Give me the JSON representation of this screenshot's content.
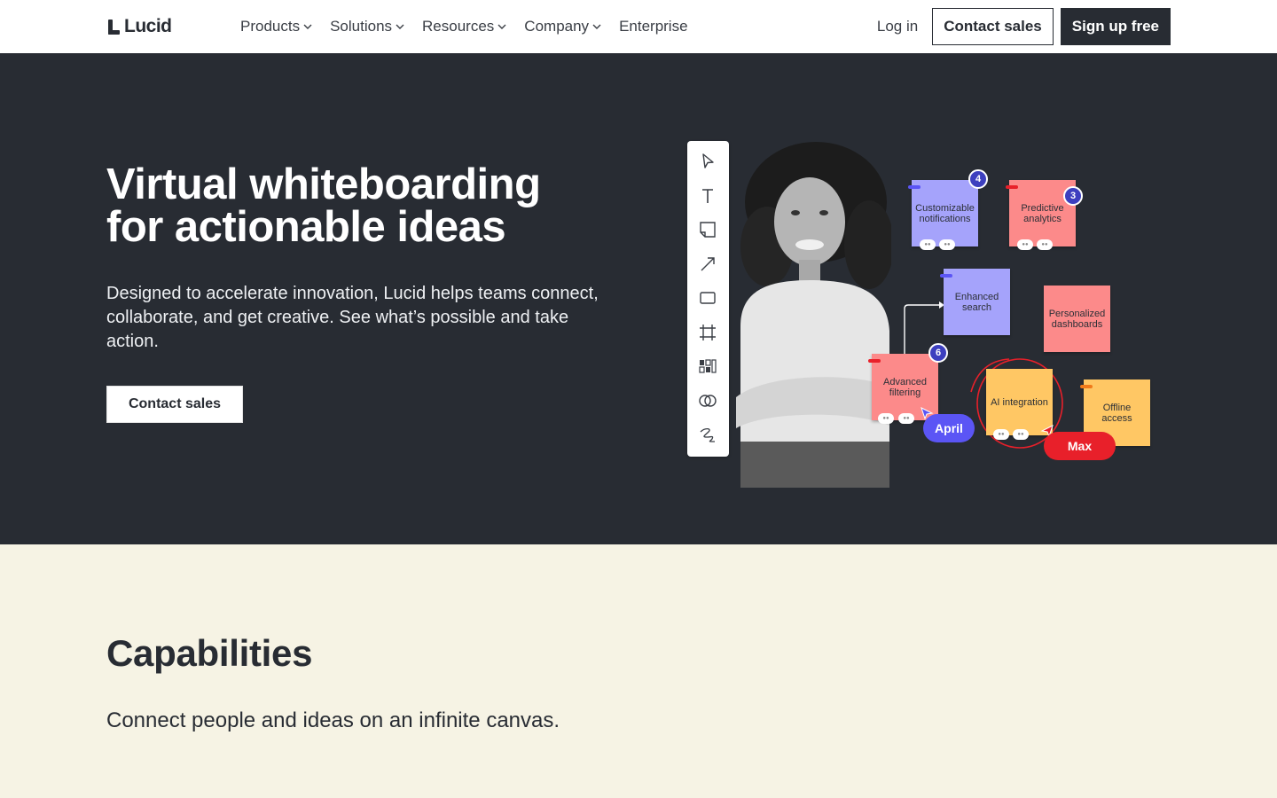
{
  "nav": {
    "logo": "Lucid",
    "menu": [
      {
        "label": "Products",
        "dropdown": true
      },
      {
        "label": "Solutions",
        "dropdown": true
      },
      {
        "label": "Resources",
        "dropdown": true
      },
      {
        "label": "Company",
        "dropdown": true
      },
      {
        "label": "Enterprise",
        "dropdown": false
      }
    ],
    "login": "Log in",
    "contact_sales": "Contact sales",
    "signup": "Sign up free"
  },
  "hero": {
    "title_line1": "Virtual whiteboarding",
    "title_line2": "for actionable ideas",
    "subtitle": "Designed to accelerate innovation, Lucid helps teams connect, collaborate, and get creative. See what’s possible and take action.",
    "cta": "Contact sales",
    "illustration": {
      "stickies": [
        {
          "label": "Customizable notifications",
          "badge": "4"
        },
        {
          "label": "Predictive analytics",
          "badge": "3"
        },
        {
          "label": "Enhanced search"
        },
        {
          "label": "Personalized dashboards"
        },
        {
          "label": "Advanced filtering",
          "badge": "6"
        },
        {
          "label": "AI integration"
        },
        {
          "label": "Offline access"
        }
      ],
      "cursors": [
        {
          "name": "April",
          "color": "#5b55f5"
        },
        {
          "name": "Max",
          "color": "#e8202a"
        }
      ]
    }
  },
  "capabilities": {
    "title": "Capabilities",
    "subtitle": "Connect people and ideas on an infinite canvas."
  },
  "colors": {
    "dark": "#282c33",
    "cream": "#f6f3e4",
    "sticky_purple": "#a5a3fb",
    "sticky_red": "#fc8a8a",
    "sticky_yellow": "#ffc764",
    "badge": "#3d3fbf"
  }
}
